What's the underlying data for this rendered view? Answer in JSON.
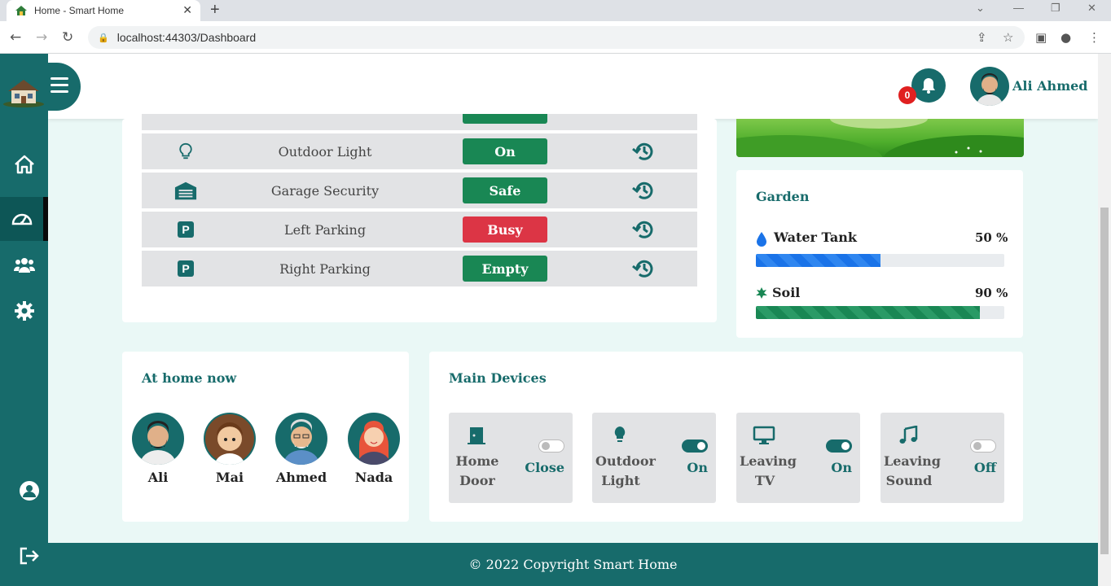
{
  "browser": {
    "tab_title": "Home - Smart Home",
    "tab_close": "✕",
    "new_tab": "+",
    "url": "localhost:44303/Dashboard",
    "win_min": "—",
    "win_restore": "❐",
    "win_close": "✕",
    "dropdown": "⌄"
  },
  "header": {
    "notification_count": "0",
    "user_name": "Ali Ahmed"
  },
  "devices": [
    {
      "name": "Outdoor Light",
      "status": "On",
      "color": "#198754",
      "icon": "lightbulb-icon"
    },
    {
      "name": "Garage Security",
      "status": "Safe",
      "color": "#198754",
      "icon": "garage-icon"
    },
    {
      "name": "Left Parking",
      "status": "Busy",
      "color": "#dc3545",
      "icon": "parking-icon"
    },
    {
      "name": "Right Parking",
      "status": "Empty",
      "color": "#198754",
      "icon": "parking-icon"
    }
  ],
  "garden": {
    "title": "Garden",
    "water_label": "Water Tank",
    "water_value": "50 %",
    "water_level": 50,
    "soil_label": "Soil",
    "soil_value": "90 %",
    "soil_level": 90,
    "water_color": "#1a73e8",
    "soil_color": "#198754"
  },
  "at_home": {
    "title": "At home now",
    "people": [
      "Ali",
      "Mai",
      "Ahmed",
      "Nada"
    ]
  },
  "main_devices": {
    "title": "Main Devices",
    "items": [
      {
        "line1": "Home",
        "line2": "Door",
        "state": "Close",
        "on": false,
        "icon": "door-icon"
      },
      {
        "line1": "Outdoor",
        "line2": "Light",
        "state": "On",
        "on": true,
        "icon": "lightbulb-icon"
      },
      {
        "line1": "Leaving",
        "line2": "TV",
        "state": "On",
        "on": true,
        "icon": "monitor-icon"
      },
      {
        "line1": "Leaving",
        "line2": "Sound",
        "state": "Off",
        "on": false,
        "icon": "music-note-icon"
      }
    ]
  },
  "footer": {
    "text": "© 2022 Copyright Smart Home"
  },
  "colors": {
    "brand": "#176b6b",
    "danger": "#dc3545",
    "success": "#198754"
  }
}
